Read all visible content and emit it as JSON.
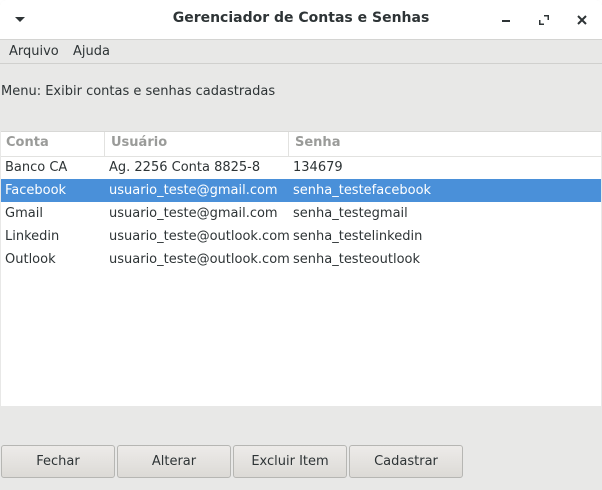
{
  "window": {
    "title": "Gerenciador de Contas e Senhas",
    "controls": {
      "menu_icon": "chevron-down-icon",
      "minimize_icon": "minimize-icon",
      "maximize_icon": "maximize-icon",
      "close_icon": "close-icon"
    }
  },
  "menubar": {
    "items": [
      {
        "label": "Arquivo"
      },
      {
        "label": "Ajuda"
      }
    ]
  },
  "status": {
    "text": "Menu: Exibir contas e senhas cadastradas"
  },
  "table": {
    "columns": [
      "Conta",
      "Usuário",
      "Senha"
    ],
    "rows": [
      {
        "conta": "Banco CA",
        "usuario": "Ag. 2256 Conta 8825-8",
        "senha": "134679",
        "selected": false
      },
      {
        "conta": "Facebook",
        "usuario": "usuario_teste@gmail.com",
        "senha": "senha_testefacebook",
        "selected": true
      },
      {
        "conta": "Gmail",
        "usuario": "usuario_teste@gmail.com",
        "senha": "senha_testegmail",
        "selected": false
      },
      {
        "conta": "Linkedin",
        "usuario": "usuario_teste@outlook.com",
        "senha": "senha_testelinkedin",
        "selected": false
      },
      {
        "conta": "Outlook",
        "usuario": "usuario_teste@outlook.com",
        "senha": "senha_testeoutlook",
        "selected": false
      }
    ],
    "selection_color": "#4a90d9"
  },
  "buttons": {
    "fechar": "Fechar",
    "alterar": "Alterar",
    "excluir": "Excluir Item",
    "cadastrar": "Cadastrar"
  }
}
